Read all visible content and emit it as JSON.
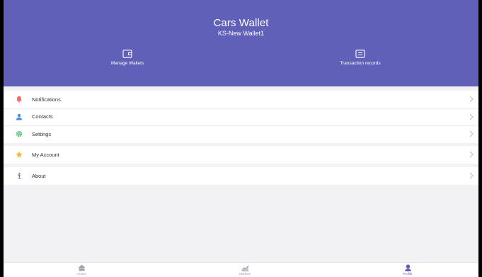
{
  "header": {
    "title": "Cars Wallet",
    "subtitle": "KS-New Wallet1",
    "actions": [
      {
        "label": "Manage Wallets",
        "icon": "wallet-icon"
      },
      {
        "label": "Transaction records",
        "icon": "records-icon"
      }
    ]
  },
  "menu": {
    "notifications": {
      "label": "Notifications",
      "icon": "bell-icon"
    },
    "contacts": {
      "label": "Contacts",
      "icon": "person-icon"
    },
    "settings": {
      "label": "Settings",
      "icon": "gear-icon"
    },
    "my_account": {
      "label": "My Account",
      "icon": "star-icon"
    },
    "about": {
      "label": "About",
      "icon": "info-icon"
    }
  },
  "tabs": [
    {
      "label": "Assets",
      "icon": "assets-icon",
      "active": false
    },
    {
      "label": "Markets",
      "icon": "markets-icon",
      "active": false
    },
    {
      "label": "Profile",
      "icon": "profile-icon",
      "active": true
    }
  ],
  "colors": {
    "header_bg": "#6060b8",
    "accent": "#6060b8",
    "bell": "#f06a6a",
    "person": "#4a90e2",
    "gear": "#3cb05a",
    "star": "#f5b82e",
    "info": "#6060b8"
  }
}
